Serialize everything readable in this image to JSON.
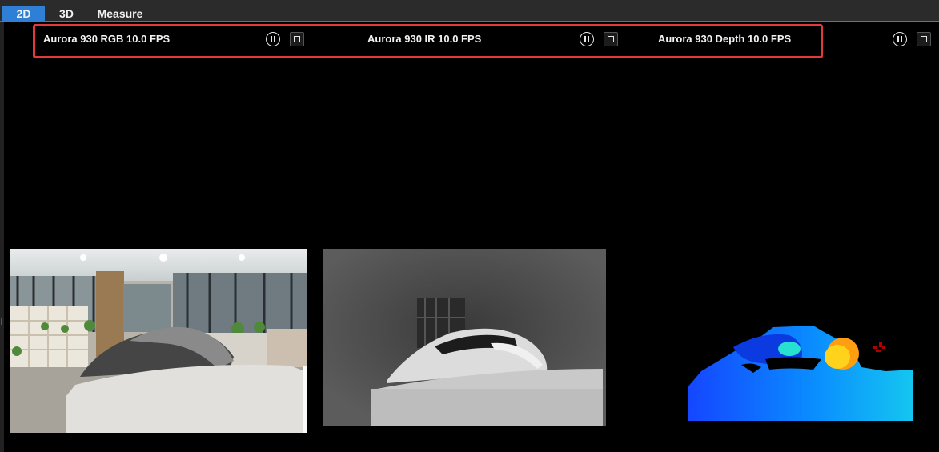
{
  "tabs": [
    {
      "label": "2D",
      "active": true
    },
    {
      "label": "3D",
      "active": false
    },
    {
      "label": "Measure",
      "active": false
    }
  ],
  "streams": [
    {
      "title": "Aurora 930 RGB  10.0 FPS",
      "pause_icon": "pause-circle-icon",
      "stop_icon": "stop-square-icon"
    },
    {
      "title": "Aurora 930 IR  10.0 FPS",
      "pause_icon": "pause-circle-icon",
      "stop_icon": "stop-square-icon"
    },
    {
      "title": "Aurora 930 Depth  10.0 FPS",
      "pause_icon": "pause-circle-icon",
      "stop_icon": "stop-square-icon"
    }
  ],
  "colors": {
    "accent": "#2f7fd6",
    "highlight_border": "#e23a3a",
    "background": "#000000",
    "tabbar": "#2b2b2b"
  }
}
